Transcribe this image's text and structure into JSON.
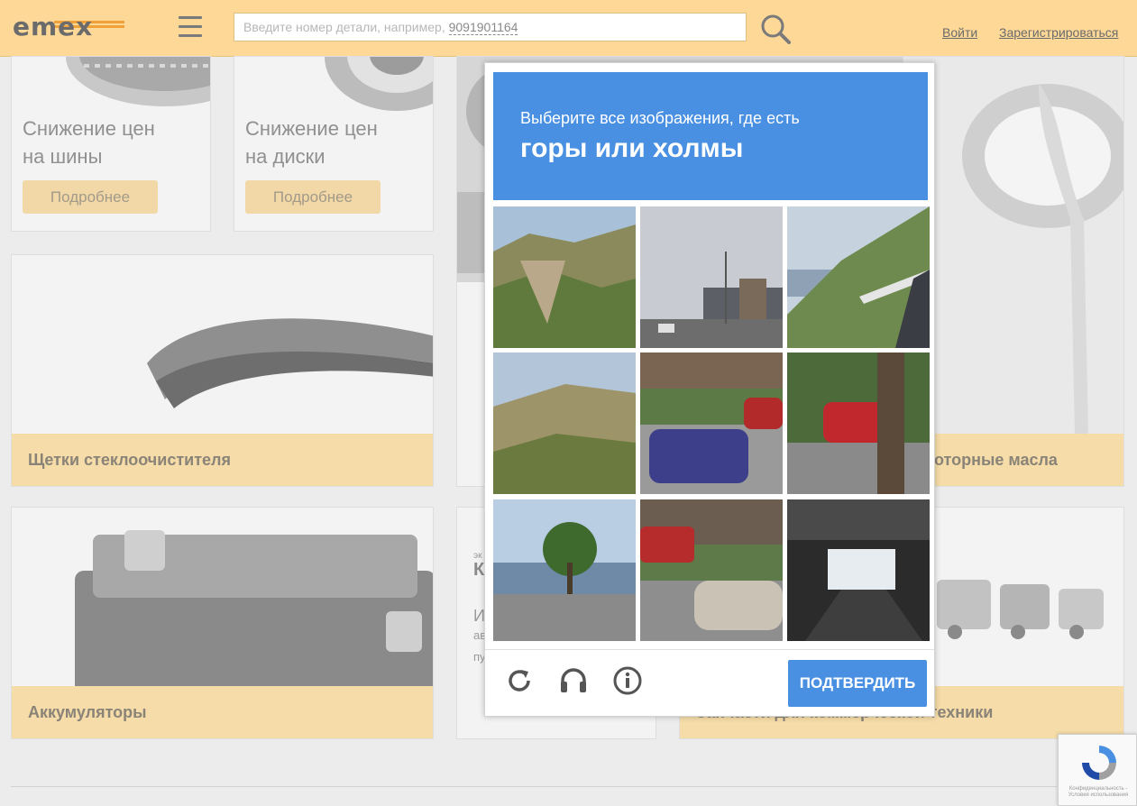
{
  "header": {
    "logo": "emex",
    "search_placeholder": "Введите номер детали, например,",
    "search_example": "9091901164",
    "login": "Войти",
    "register": "Зарегистрироваться"
  },
  "promos": [
    {
      "title_line1": "Снижение цен",
      "title_line2": "на шины",
      "button": "Подробнее"
    },
    {
      "title_line1": "Снижение цен",
      "title_line2": "на диски",
      "button": "Подробнее"
    }
  ],
  "categories": {
    "wipers": "Щетки стеклоочистителя",
    "oils": "оторные масла",
    "batteries": "Аккумуляторы",
    "commercial": "Запчасти для коммерческой техники"
  },
  "middle_card": {
    "small": "эк",
    "heading": "К",
    "line1": "И",
    "line2": "ав",
    "line3": "пу"
  },
  "captcha": {
    "instruction": "Выберите все изображения, где есть",
    "object": "горы или холмы",
    "verify_button": "ПОДТВЕРДИТЬ",
    "tiles": [
      "hills-tile",
      "city-street-tile",
      "coast-hill-tile",
      "hillside-tile",
      "parked-cars-tile",
      "red-car-tree-tile",
      "lakeside-road-tile",
      "street-cars-tile",
      "tunnel-tile"
    ],
    "accent_color": "#4a90e2"
  },
  "recaptcha_badge": {
    "text": "Конфиденциальность - Условия использования"
  }
}
